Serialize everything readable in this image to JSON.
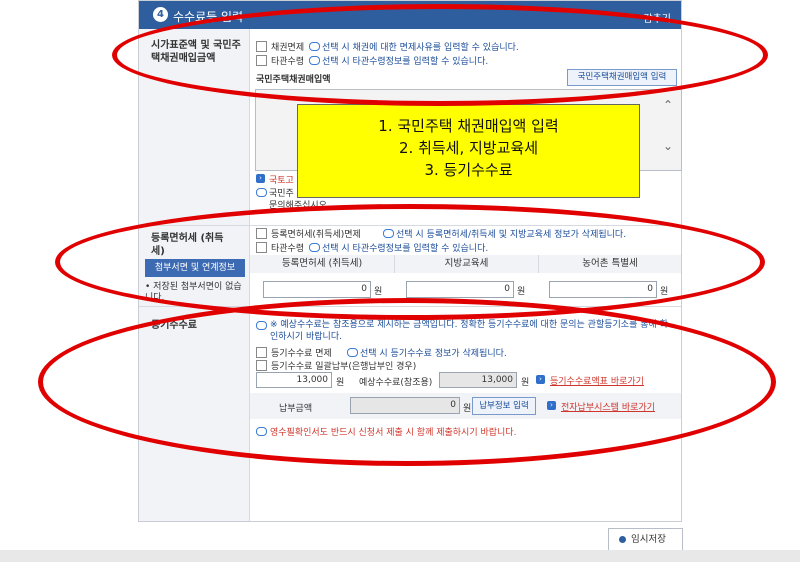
{
  "header": {
    "step": "4",
    "title": "수수료등 입력",
    "right": "감추기"
  },
  "sec1": {
    "label": "시가표준액 및 국민주택채권매입금액",
    "opt1": {
      "label": "채권면제",
      "note": "선택 시 채권에 대한 면제사유를 입력할 수 있습니다."
    },
    "opt2": {
      "label": "타관수령",
      "note": "선택 시 타관수령정보를 입력할 수 있습니다."
    },
    "sub_title": "국민주택채권매입액",
    "button": "국민주택채권매입액 입력",
    "link1": "국토고",
    "note2": "국민주",
    "note3": "문의해주십시오."
  },
  "callout": {
    "line1": "1.  국민주택 채권매입액 입력",
    "line2": "2.  취득세, 지방교육세",
    "line3": "3. 등기수수료"
  },
  "sec2": {
    "label": "등록면허세 (취득세)",
    "opt1": {
      "label": "등록면허세(취득세)면제",
      "note": "선택 시 등록면허세/취득세 및 지방교육세 정보가 삭제됩니다."
    },
    "opt2": {
      "label": "타관수령",
      "note": "선택 시 타관수령정보를 입력할 수 있습니다."
    },
    "attach_button": "첨부서면 및 연계정보",
    "attach_note": "• 저장된 첨부서면이 없습니다.",
    "columns": [
      "등록면허세 (취득세)",
      "지방교육세",
      "농어촌 특별세"
    ],
    "values": [
      "0",
      "0",
      "0"
    ],
    "unit": "원"
  },
  "sec3": {
    "label": "등기수수료",
    "info": "※ 예상수수료는 참조용으로 제시하는 금액입니다. 정확한 등기수수료에 대한 문의는 관할등기소를 통해 확인하시기 바랍니다.",
    "opt1": {
      "label": "등기수수료 면제",
      "note": "선택 시 등기수수료 정보가 삭제됩니다."
    },
    "opt2": {
      "label": "등기수수료 일괄납부(은행납부인 경우)"
    },
    "fee_value": "13,000",
    "unit": "원",
    "expected_label": "예상수수료(참조용)",
    "expected_value": "13,000",
    "link_fee_table": "등기수수료액표 바로가기",
    "pay_label": "납부금액",
    "pay_value": "0",
    "pay_button": "납부정보 입력",
    "link_epay": "전자납부시스템 바로가기",
    "bottom_note": "영수필확인서도 반드시 신청서 제출 시 함께 제출하시기 바랍니다."
  },
  "footer": {
    "save_button": "임시저장"
  }
}
